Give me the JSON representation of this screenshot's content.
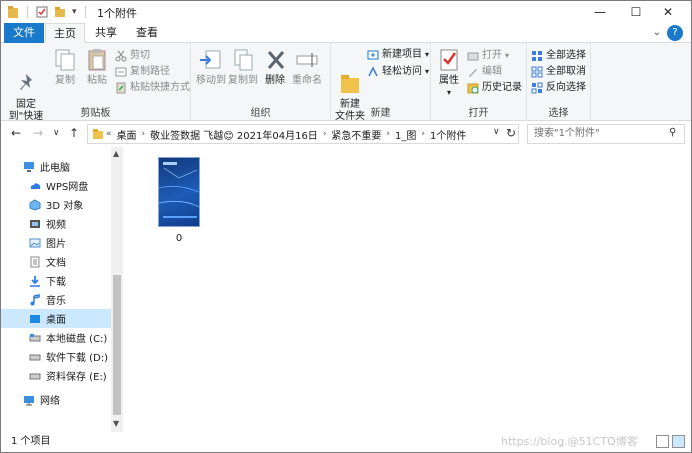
{
  "window": {
    "title": "1个附件",
    "controls": {
      "minimize": "—",
      "maximize": "☐",
      "close": "✕"
    }
  },
  "ribbon_tabs": [
    "文件",
    "主页",
    "共享",
    "查看"
  ],
  "ribbon": {
    "clipboard": {
      "label": "剪贴板",
      "pin": "固定到\"快速访问\"",
      "copy": "复制",
      "paste": "粘贴",
      "cut": "剪切",
      "copy_path": "复制路径",
      "paste_shortcut": "粘贴快捷方式"
    },
    "organize": {
      "label": "组织",
      "move_to": "移动到",
      "copy_to": "复制到",
      "delete": "删除",
      "rename": "重命名"
    },
    "new": {
      "label": "新建",
      "new_folder": "新建\n文件夹",
      "new_item": "新建项目",
      "easy_access": "轻松访问"
    },
    "open": {
      "label": "打开",
      "properties": "属性",
      "open": "打开",
      "edit": "编辑",
      "history": "历史记录"
    },
    "select": {
      "label": "选择",
      "select_all": "全部选择",
      "select_none": "全部取消",
      "invert": "反向选择"
    }
  },
  "address": {
    "crumbs": [
      "桌面",
      "敬业签数据 飞越😊 2021年04月16日",
      "紧急不重要",
      "1_图",
      "1个附件"
    ],
    "search_placeholder": "搜索\"1个附件\""
  },
  "nav_pane": {
    "items": [
      {
        "label": "此电脑",
        "icon": "pc-icon"
      },
      {
        "label": "WPS网盘",
        "icon": "cloud-icon"
      },
      {
        "label": "3D 对象",
        "icon": "cube-icon"
      },
      {
        "label": "视频",
        "icon": "video-icon"
      },
      {
        "label": "图片",
        "icon": "pictures-icon"
      },
      {
        "label": "文档",
        "icon": "documents-icon"
      },
      {
        "label": "下载",
        "icon": "download-icon"
      },
      {
        "label": "音乐",
        "icon": "music-icon"
      },
      {
        "label": "桌面",
        "icon": "desktop-icon",
        "selected": true
      },
      {
        "label": "本地磁盘 (C:)",
        "icon": "drive-icon"
      },
      {
        "label": "软件下载 (D:)",
        "icon": "drive-icon"
      },
      {
        "label": "资料保存 (E:)",
        "icon": "drive-icon"
      },
      {
        "label": "网络",
        "icon": "network-icon"
      }
    ]
  },
  "files": [
    {
      "name": "0",
      "type": "image"
    }
  ],
  "status": {
    "count": "1 个项目",
    "watermark": "https://blog.@51CTO博客"
  },
  "colors": {
    "accent": "#1979ca",
    "selection": "#cce8ff",
    "ribbon_bg": "#f5f6f7"
  }
}
